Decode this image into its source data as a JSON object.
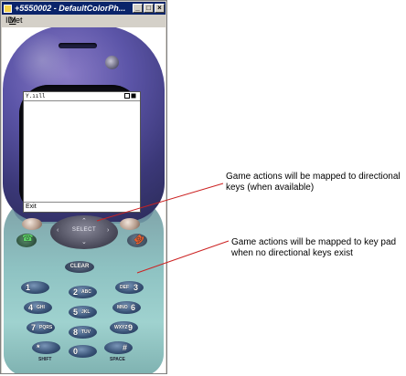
{
  "window": {
    "title": "+5550002 - DefaultColorPh...",
    "menu_item": "MIDlet",
    "menu_mnemonic": "M",
    "menu_rest": "IDlet",
    "minimize_glyph": "_",
    "maximize_glyph": "□",
    "close_glyph": "×"
  },
  "phone": {
    "screen": {
      "signal_text": "Y.ııll",
      "softkey_left": "Exit"
    },
    "dpad_label": "SELECT",
    "clear_label": "CLEAR",
    "keys": [
      {
        "digit": "1",
        "letters": ""
      },
      {
        "digit": "2",
        "letters": "ABC"
      },
      {
        "digit": "3",
        "letters": "DEF"
      },
      {
        "digit": "4",
        "letters": "GHI"
      },
      {
        "digit": "5",
        "letters": "JKL"
      },
      {
        "digit": "6",
        "letters": "MNO"
      },
      {
        "digit": "7",
        "letters": "PQRS"
      },
      {
        "digit": "8",
        "letters": "TUV"
      },
      {
        "digit": "9",
        "letters": "WXYZ"
      },
      {
        "digit": "*",
        "letters": ""
      },
      {
        "digit": "0",
        "letters": ""
      },
      {
        "digit": "#",
        "letters": ""
      }
    ],
    "shift_label": "SHIFT",
    "space_label": "SPACE",
    "colors": {
      "top_shell": "#5c55a8",
      "bottom_shell": "#8ec2c2",
      "keypad_key": "#3a5478",
      "title_bar": "#0a246a"
    }
  },
  "annotations": {
    "directional": "Game actions will be mapped to directional keys (when available)",
    "keypad": "Game actions will be mapped to key pad when no directional keys exist",
    "pointer_color": "#cc2222"
  }
}
